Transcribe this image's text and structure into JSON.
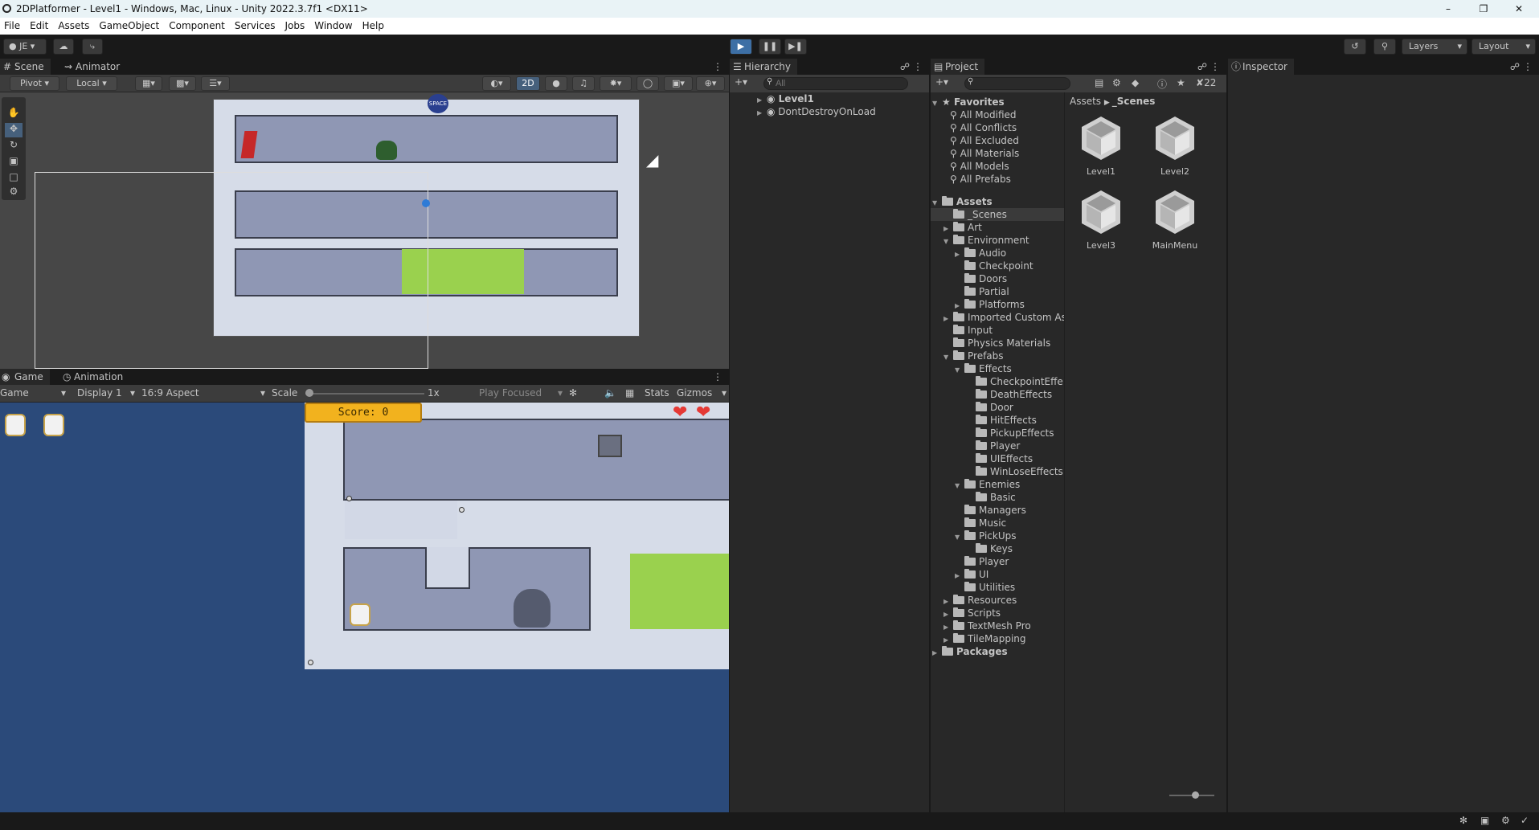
{
  "window": {
    "title": "2DPlatformer - Level1 - Windows, Mac, Linux - Unity 2022.3.7f1 <DX11>",
    "controls": [
      "minimize-icon",
      "maximize-icon",
      "close-icon"
    ]
  },
  "menu": [
    "File",
    "Edit",
    "Assets",
    "GameObject",
    "Component",
    "Services",
    "Jobs",
    "Window",
    "Help"
  ],
  "toolbar": {
    "account": "JE",
    "layers_label": "Layers",
    "layout_label": "Layout",
    "play_accent": "#3d6fa5"
  },
  "scene": {
    "tabs": [
      "Scene",
      "Animator"
    ],
    "pivot": "Pivot",
    "local": "Local",
    "mode_2d": "2D",
    "space_label": "SPACE"
  },
  "game": {
    "tabs": [
      "Game",
      "Animation"
    ],
    "game_select": "Game",
    "display": "Display 1",
    "aspect": "16:9 Aspect",
    "scale_label": "Scale",
    "scale_value": "1x",
    "play_focused": "Play Focused",
    "stats": "Stats",
    "gizmos": "Gizmos",
    "score": "Score: 0",
    "lives": 2,
    "bg_color": "#2b4a7a"
  },
  "hierarchy": {
    "tab": "Hierarchy",
    "search_placeholder": "All",
    "items": [
      "Level1",
      "DontDestroyOnLoad"
    ]
  },
  "project": {
    "tab": "Project",
    "hidden_count": "22",
    "favorites_label": "Favorites",
    "favorites": [
      "All Modified",
      "All Conflicts",
      "All Excluded",
      "All Materials",
      "All Models",
      "All Prefabs"
    ],
    "breadcrumb": [
      "Assets",
      "_Scenes"
    ],
    "tree": [
      {
        "label": "Assets",
        "depth": 0,
        "arrow": "open",
        "bold": true
      },
      {
        "label": "_Scenes",
        "depth": 1,
        "arrow": "",
        "selected": true
      },
      {
        "label": "Art",
        "depth": 1,
        "arrow": "closed"
      },
      {
        "label": "Environment",
        "depth": 1,
        "arrow": "open"
      },
      {
        "label": "Audio",
        "depth": 2,
        "arrow": "closed"
      },
      {
        "label": "Checkpoint",
        "depth": 2,
        "arrow": ""
      },
      {
        "label": "Doors",
        "depth": 2,
        "arrow": ""
      },
      {
        "label": "Partial",
        "depth": 2,
        "arrow": ""
      },
      {
        "label": "Platforms",
        "depth": 2,
        "arrow": "closed"
      },
      {
        "label": "Imported Custom Ass",
        "depth": 1,
        "arrow": "closed"
      },
      {
        "label": "Input",
        "depth": 1,
        "arrow": ""
      },
      {
        "label": "Physics Materials",
        "depth": 1,
        "arrow": ""
      },
      {
        "label": "Prefabs",
        "depth": 1,
        "arrow": "open"
      },
      {
        "label": "Effects",
        "depth": 2,
        "arrow": "open"
      },
      {
        "label": "CheckpointEffe",
        "depth": 3,
        "arrow": ""
      },
      {
        "label": "DeathEffects",
        "depth": 3,
        "arrow": ""
      },
      {
        "label": "Door",
        "depth": 3,
        "arrow": ""
      },
      {
        "label": "HitEffects",
        "depth": 3,
        "arrow": ""
      },
      {
        "label": "PickupEffects",
        "depth": 3,
        "arrow": ""
      },
      {
        "label": "Player",
        "depth": 3,
        "arrow": ""
      },
      {
        "label": "UIEffects",
        "depth": 3,
        "arrow": ""
      },
      {
        "label": "WinLoseEffects",
        "depth": 3,
        "arrow": ""
      },
      {
        "label": "Enemies",
        "depth": 2,
        "arrow": "open"
      },
      {
        "label": "Basic",
        "depth": 3,
        "arrow": ""
      },
      {
        "label": "Managers",
        "depth": 2,
        "arrow": ""
      },
      {
        "label": "Music",
        "depth": 2,
        "arrow": ""
      },
      {
        "label": "PickUps",
        "depth": 2,
        "arrow": "open"
      },
      {
        "label": "Keys",
        "depth": 3,
        "arrow": ""
      },
      {
        "label": "Player",
        "depth": 2,
        "arrow": ""
      },
      {
        "label": "UI",
        "depth": 2,
        "arrow": "closed"
      },
      {
        "label": "Utilities",
        "depth": 2,
        "arrow": ""
      },
      {
        "label": "Resources",
        "depth": 1,
        "arrow": "closed"
      },
      {
        "label": "Scripts",
        "depth": 1,
        "arrow": "closed"
      },
      {
        "label": "TextMesh Pro",
        "depth": 1,
        "arrow": "closed"
      },
      {
        "label": "TileMapping",
        "depth": 1,
        "arrow": "closed"
      },
      {
        "label": "Packages",
        "depth": 0,
        "arrow": "closed",
        "bold": true
      }
    ],
    "assets": [
      "Level1",
      "Level2",
      "Level3",
      "MainMenu"
    ]
  },
  "inspector": {
    "tab": "Inspector"
  }
}
